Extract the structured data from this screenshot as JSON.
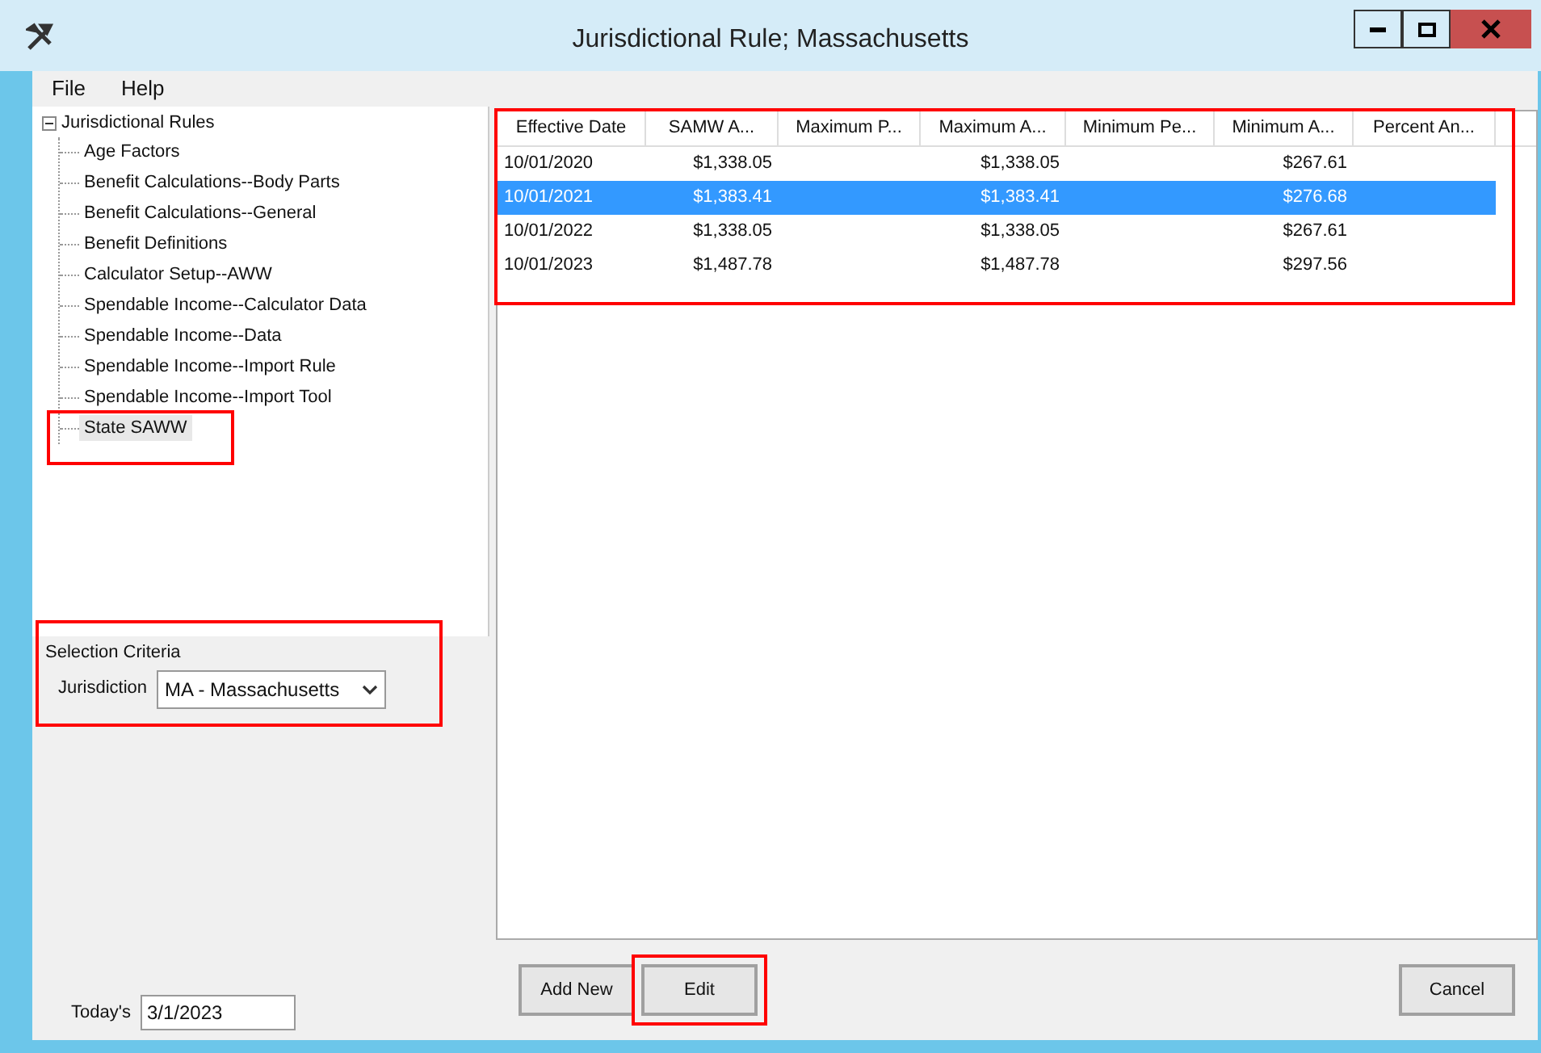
{
  "window": {
    "title": "Jurisdictional Rule; Massachusetts"
  },
  "menu": [
    "File",
    "Help"
  ],
  "tree": {
    "label": "Jurisdictional Rules",
    "expanded": true,
    "children": [
      {
        "label": "Age Factors",
        "selected": false,
        "highlighted": false
      },
      {
        "label": "Benefit Calculations--Body Parts",
        "selected": false,
        "highlighted": false
      },
      {
        "label": "Benefit Calculations--General",
        "selected": false,
        "highlighted": false
      },
      {
        "label": "Benefit Definitions",
        "selected": false,
        "highlighted": false
      },
      {
        "label": "Calculator Setup--AWW",
        "selected": false,
        "highlighted": false
      },
      {
        "label": "Spendable Income--Calculator Data",
        "selected": false,
        "highlighted": false
      },
      {
        "label": "Spendable Income--Data",
        "selected": false,
        "highlighted": false
      },
      {
        "label": "Spendable Income--Import Rule",
        "selected": false,
        "highlighted": false
      },
      {
        "label": "Spendable Income--Import Tool",
        "selected": false,
        "highlighted": false
      },
      {
        "label": "State SAWW",
        "selected": true,
        "highlighted": true
      }
    ]
  },
  "selection_criteria": {
    "title": "Selection Criteria",
    "jurisdiction_label": "Jurisdiction",
    "jurisdiction_value": "MA - Massachusetts",
    "highlighted": true
  },
  "todays": {
    "label": "Today's",
    "value": "3/1/2023"
  },
  "table": {
    "highlighted": true,
    "columns": [
      "Effective Date",
      "SAMW A...",
      "Maximum P...",
      "Maximum A...",
      "Minimum Pe...",
      "Minimum A...",
      "Percent An..."
    ],
    "rows": [
      {
        "cells": [
          "10/01/2020",
          "$1,338.05",
          "",
          "$1,338.05",
          "",
          "$267.61",
          ""
        ],
        "selected": false
      },
      {
        "cells": [
          "10/01/2021",
          "$1,383.41",
          "",
          "$1,383.41",
          "",
          "$276.68",
          ""
        ],
        "selected": true
      },
      {
        "cells": [
          "10/01/2022",
          "$1,338.05",
          "",
          "$1,338.05",
          "",
          "$267.61",
          ""
        ],
        "selected": false
      },
      {
        "cells": [
          "10/01/2023",
          "$1,487.78",
          "",
          "$1,487.78",
          "",
          "$297.56",
          ""
        ],
        "selected": false
      }
    ]
  },
  "buttons": [
    {
      "label": "Add New",
      "highlighted": false
    },
    {
      "label": "Edit",
      "highlighted": true
    },
    {
      "label": "Cancel",
      "highlighted": false
    }
  ]
}
